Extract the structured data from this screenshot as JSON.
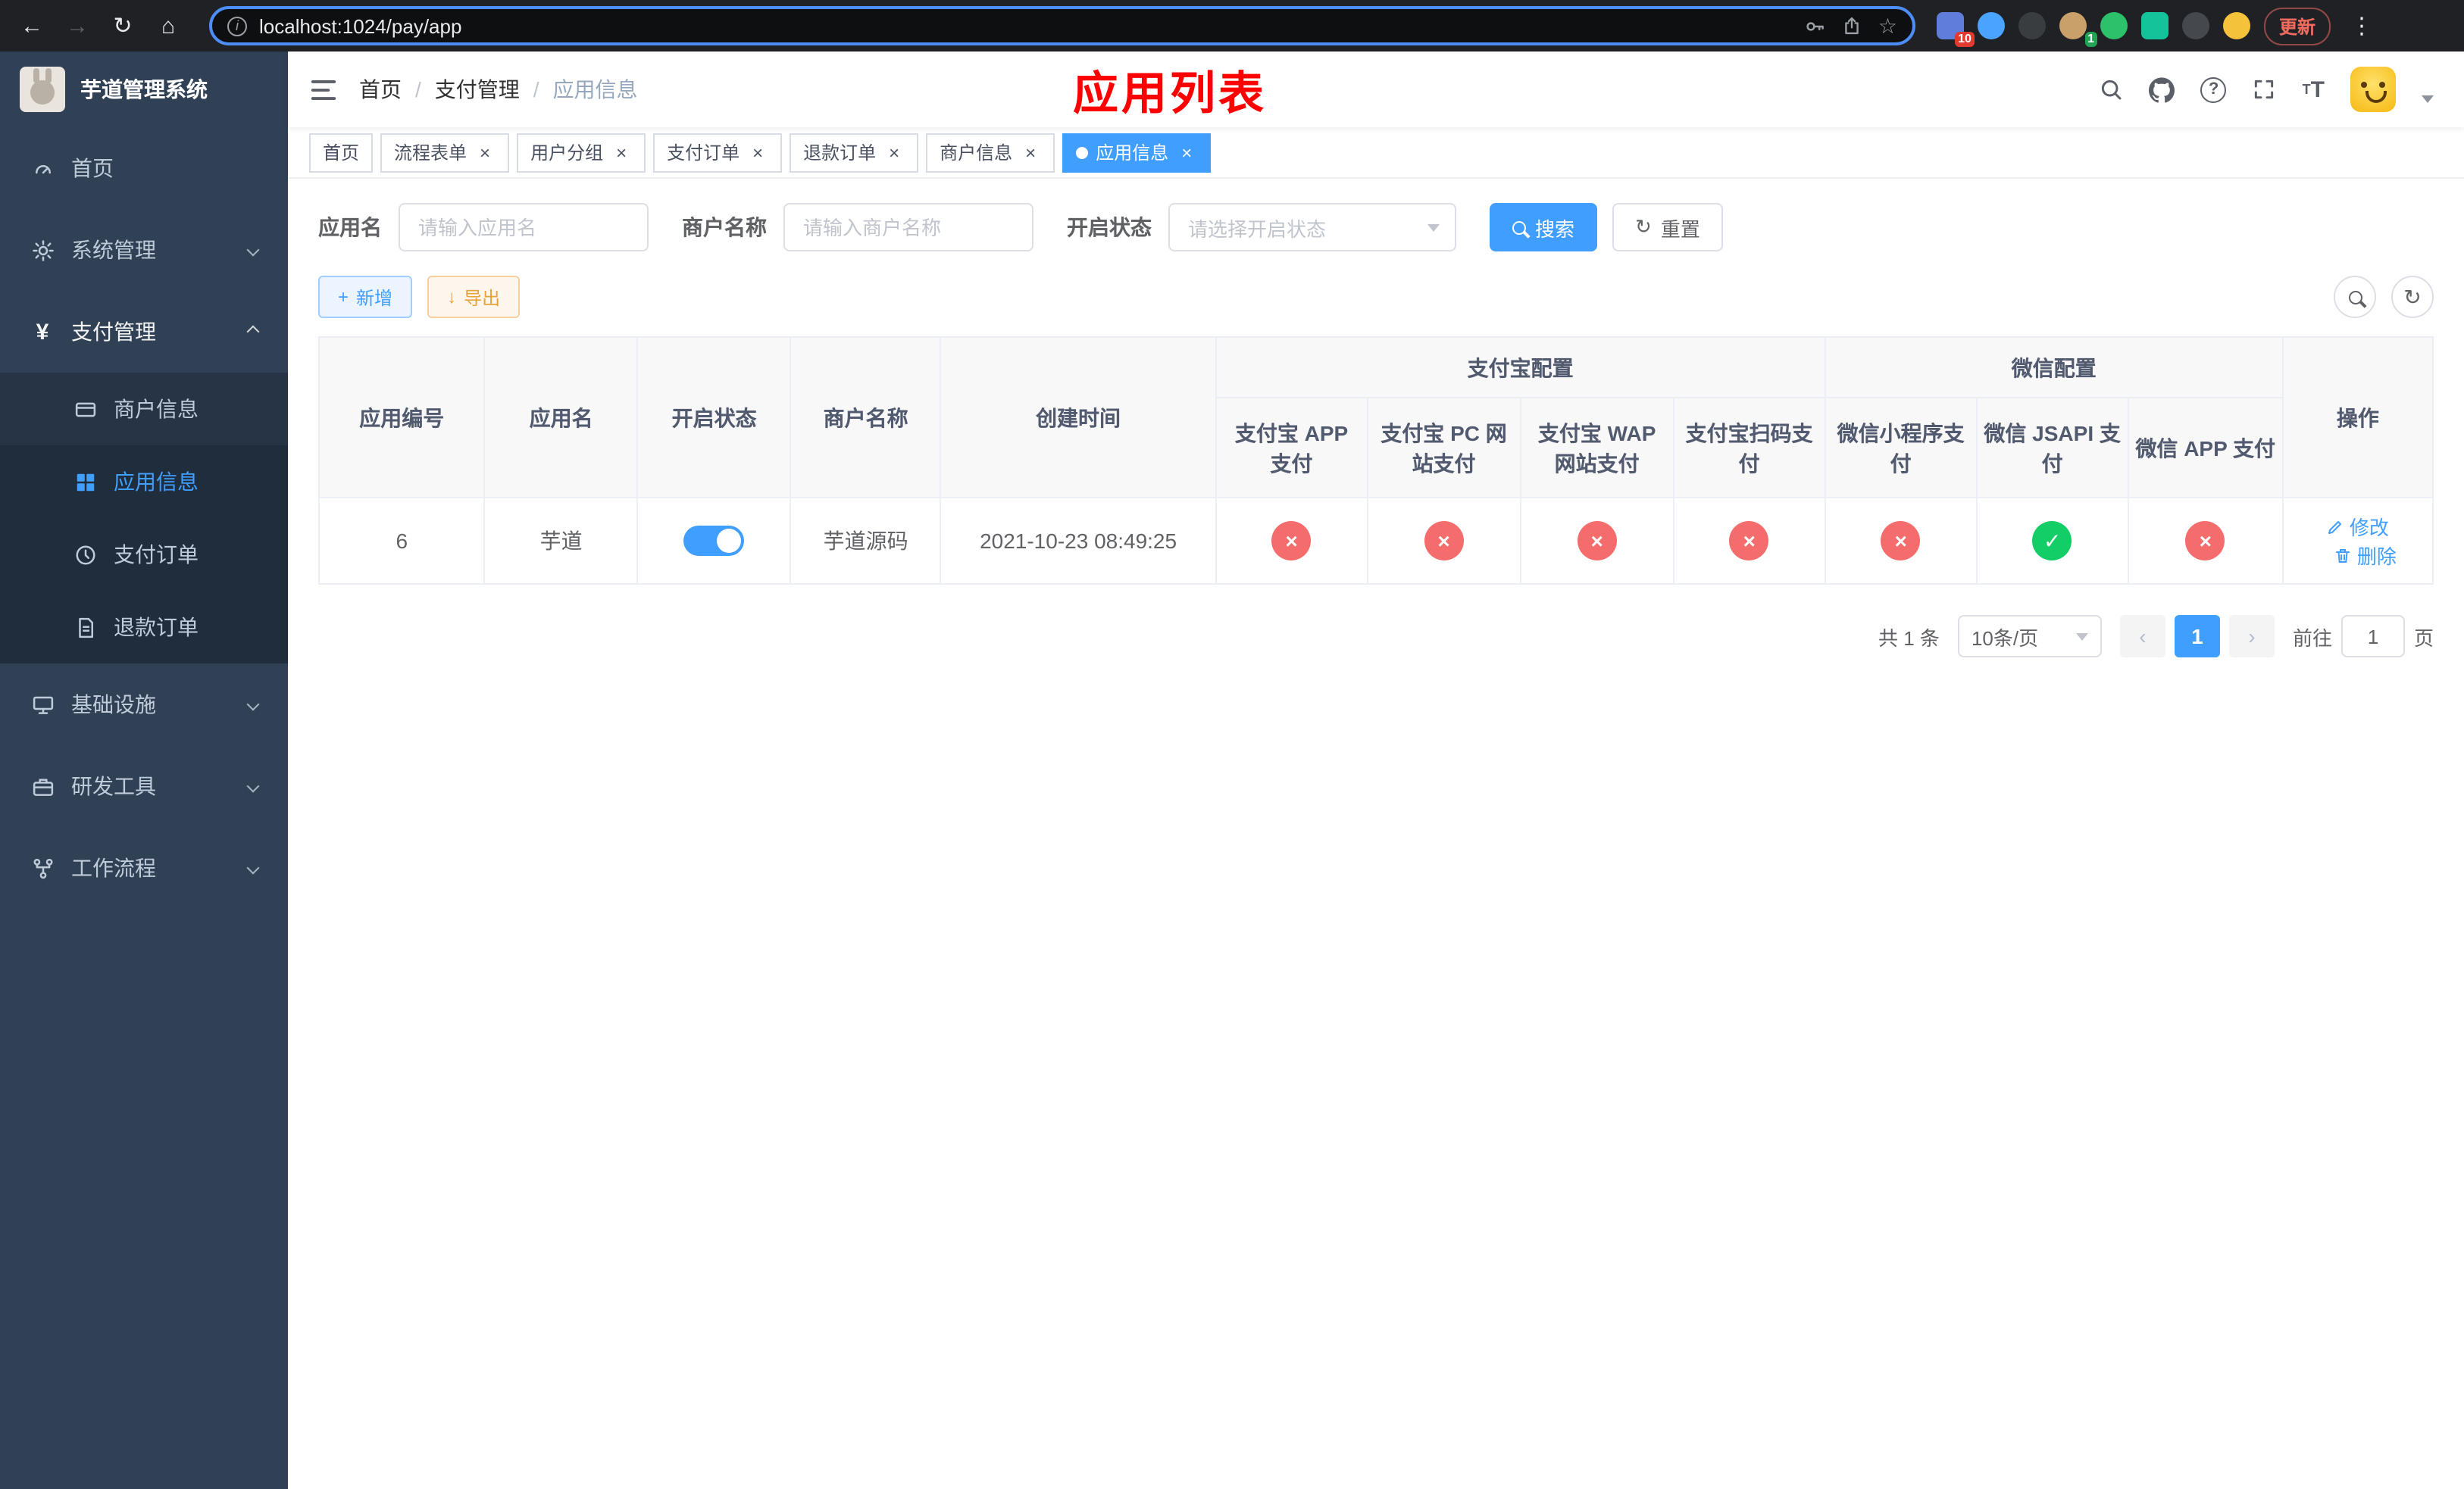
{
  "browser": {
    "url": "localhost:1024/pay/app",
    "update_button": "更新",
    "ext_badge_1": "10",
    "ext_badge_2": "1"
  },
  "icons": {
    "back": "←",
    "forward": "→",
    "reload": "↻",
    "home": "⌂",
    "star": "☆",
    "menu_dots": "⋮",
    "info": "i",
    "yen": "¥",
    "question": "?",
    "close": "×",
    "check": "✓",
    "cross": "×",
    "prev": "‹",
    "next": "›",
    "plus": "+",
    "download": "↓",
    "refresh": "↻",
    "font_small": "T",
    "font_big": "T"
  },
  "sidebar": {
    "app_title": "芋道管理系统",
    "items": [
      {
        "label": "首页"
      },
      {
        "label": "系统管理"
      },
      {
        "label": "支付管理"
      },
      {
        "label": "基础设施"
      },
      {
        "label": "研发工具"
      },
      {
        "label": "工作流程"
      }
    ],
    "pay_submenu": [
      {
        "label": "商户信息"
      },
      {
        "label": "应用信息"
      },
      {
        "label": "支付订单"
      },
      {
        "label": "退款订单"
      }
    ]
  },
  "header": {
    "breadcrumb": [
      "首页",
      "支付管理",
      "应用信息"
    ],
    "breadcrumb_separator": "/",
    "page_title": "应用列表"
  },
  "tabs": [
    {
      "label": "首页",
      "closable": false,
      "active": false
    },
    {
      "label": "流程表单",
      "closable": true,
      "active": false
    },
    {
      "label": "用户分组",
      "closable": true,
      "active": false
    },
    {
      "label": "支付订单",
      "closable": true,
      "active": false
    },
    {
      "label": "退款订单",
      "closable": true,
      "active": false
    },
    {
      "label": "商户信息",
      "closable": true,
      "active": false
    },
    {
      "label": "应用信息",
      "closable": true,
      "active": true
    }
  ],
  "filters": {
    "app_name": {
      "label": "应用名",
      "placeholder": "请输入应用名"
    },
    "merchant_name": {
      "label": "商户名称",
      "placeholder": "请输入商户名称"
    },
    "status": {
      "label": "开启状态",
      "placeholder": "请选择开启状态"
    },
    "search": "搜索",
    "reset": "重置"
  },
  "toolbar": {
    "add": "新增",
    "export": "导出"
  },
  "table": {
    "groups": {
      "alipay": "支付宝配置",
      "wechat": "微信配置"
    },
    "columns": {
      "id": "应用编号",
      "name": "应用名",
      "status": "开启状态",
      "merchant": "商户名称",
      "created": "创建时间",
      "alipay_app": "支付宝 APP 支付",
      "alipay_pc": "支付宝 PC 网站支付",
      "alipay_wap": "支付宝 WAP 网站支付",
      "alipay_qr": "支付宝扫码支付",
      "wx_mini": "微信小程序支付",
      "wx_jsapi": "微信 JSAPI 支付",
      "wx_app": "微信 APP 支付",
      "actions": "操作"
    },
    "row": {
      "id": "6",
      "name": "芋道",
      "status_on": true,
      "merchant": "芋道源码",
      "created": "2021-10-23 08:49:25",
      "configs": [
        "no",
        "no",
        "no",
        "no",
        "no",
        "yes",
        "no"
      ],
      "edit": "修改",
      "delete": "删除"
    }
  },
  "pagination": {
    "total": "共 1 条",
    "page_size": "10条/页",
    "page": "1",
    "goto_prefix": "前往",
    "goto_value": "1",
    "goto_suffix": "页"
  }
}
